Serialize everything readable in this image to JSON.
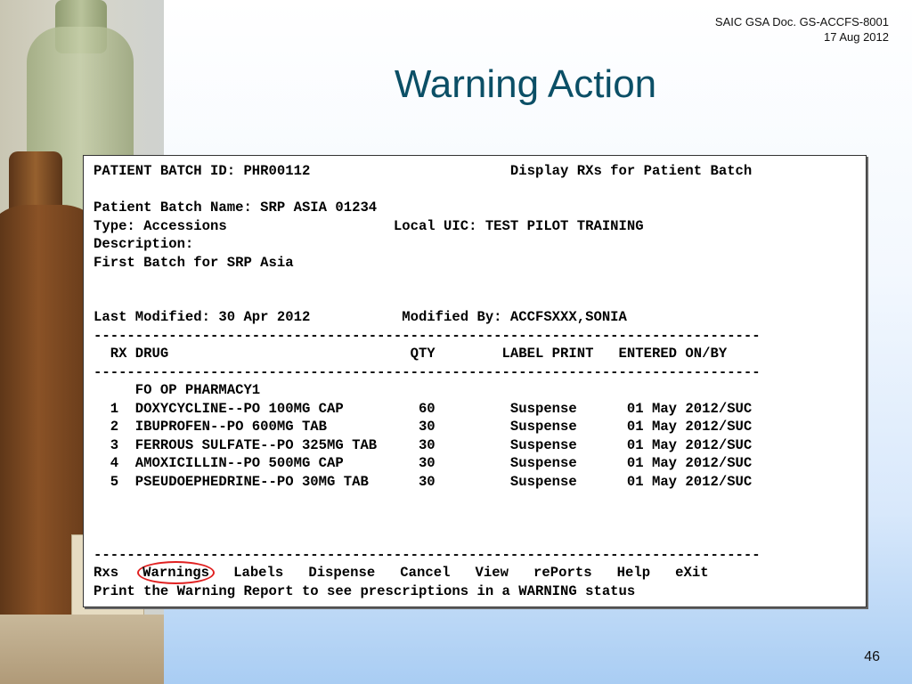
{
  "header": {
    "doc_ref_line1": "SAIC GSA Doc. GS-ACCFS-8001",
    "doc_ref_line2": "17 Aug 2012"
  },
  "title": "Warning Action",
  "page_number": "46",
  "terminal": {
    "batch_id_line": "PATIENT BATCH ID: PHR00112                        Display RXs for Patient Batch",
    "batch_name_line": "Patient Batch Name: SRP ASIA 01234",
    "type_line": "Type: Accessions                    Local UIC: TEST PILOT TRAINING",
    "description_label": "Description:",
    "description_value": "First Batch for SRP Asia",
    "modified_line": "Last Modified: 30 Apr 2012           Modified By: ACCFSXXX,SONIA",
    "divider": "--------------------------------------------------------------------------------",
    "column_header": "  RX DRUG                             QTY        LABEL PRINT   ENTERED ON/BY",
    "pharmacy": "     FO OP PHARMACY1",
    "rows": [
      "  1  DOXYCYCLINE--PO 100MG CAP         60         Suspense      01 May 2012/SUC",
      "  2  IBUPROFEN--PO 600MG TAB           30         Suspense      01 May 2012/SUC",
      "  3  FERROUS SULFATE--PO 325MG TAB     30         Suspense      01 May 2012/SUC",
      "  4  AMOXICILLIN--PO 500MG CAP         30         Suspense      01 May 2012/SUC",
      "  5  PSEUDOEPHEDRINE--PO 30MG TAB      30         Suspense      01 May 2012/SUC"
    ],
    "menu": [
      "Rxs",
      "Warnings",
      "Labels",
      "Dispense",
      "Cancel",
      "View",
      "rePorts",
      "Help",
      "eXit"
    ],
    "status_message": "Print the Warning Report to see prescriptions in a WARNING status"
  }
}
